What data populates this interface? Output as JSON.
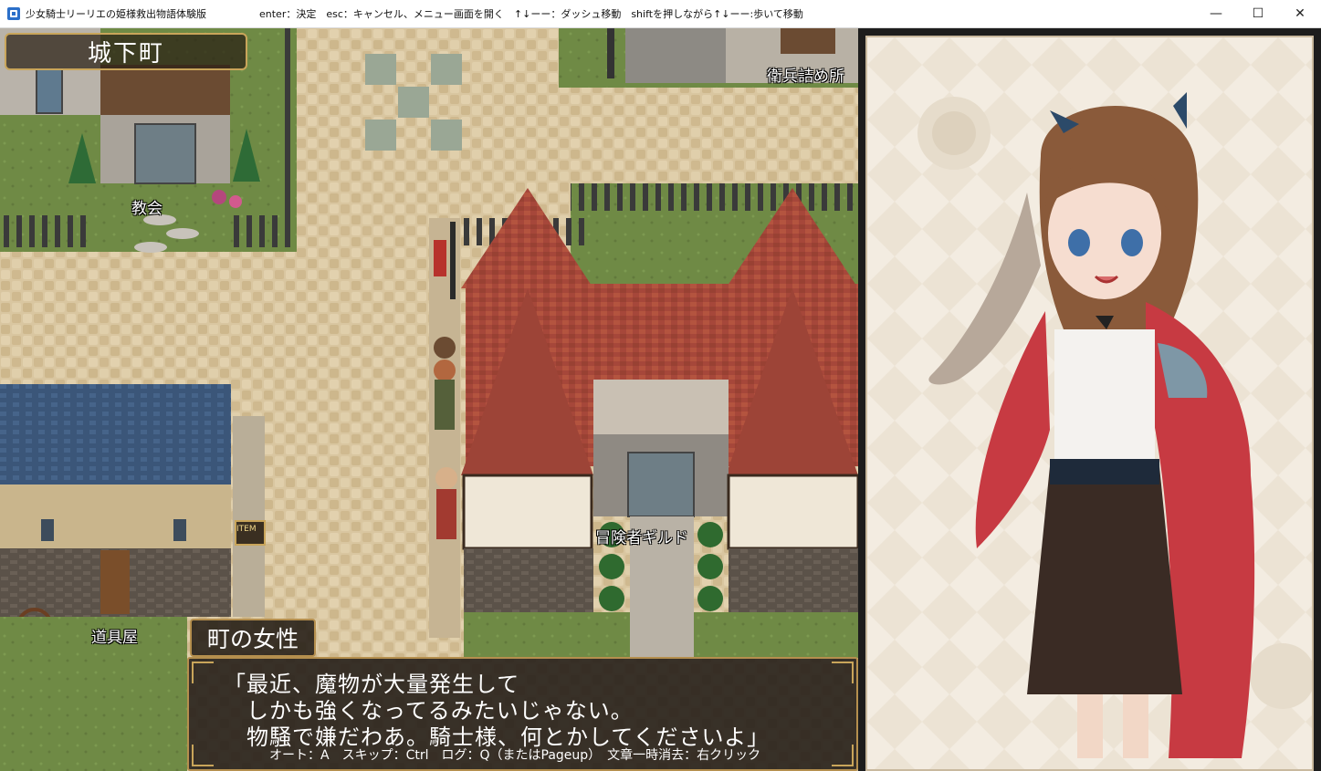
{
  "window": {
    "title": "少女騎士リーリエの姫様救出物語体験版",
    "controls_hint": "enter：決定　esc：キャンセル、メニュー画面を開く　↑↓ーー：ダッシュ移動　shiftを押しながら↑↓ーー:歩いて移動",
    "minimize": "—",
    "maximize": "☐",
    "close": "✕"
  },
  "map": {
    "location_name": "城下町",
    "labels": {
      "church": "教会",
      "guard_post": "衛兵詰め所",
      "adventurer_guild": "冒険者ギルド",
      "item_shop": "道具屋"
    },
    "shop_sign": "ITEM"
  },
  "dialog": {
    "speaker": "町の女性",
    "lines": [
      "「最近、魔物が大量発生して",
      "　しかも強くなってるみたいじゃない。",
      "　物騒で嫌だわあ。騎士様、何とかしてくださいよ」"
    ],
    "controls_hint": "オート：A　スキップ：Ctrl　ログ：Q（またはPageup）　文章一時消去：右クリック"
  },
  "colors": {
    "cobblestone": "#d7c39d",
    "grass": "#6f8a45",
    "roof_red": "#a9493a",
    "roof_blue": "#3b5679",
    "dialog_bg": "#261f19",
    "dialog_border": "#b58f4e",
    "portrait_bg": "#f3ece1",
    "cape_red": "#c73a42",
    "hair_brown": "#8a5a3a"
  }
}
